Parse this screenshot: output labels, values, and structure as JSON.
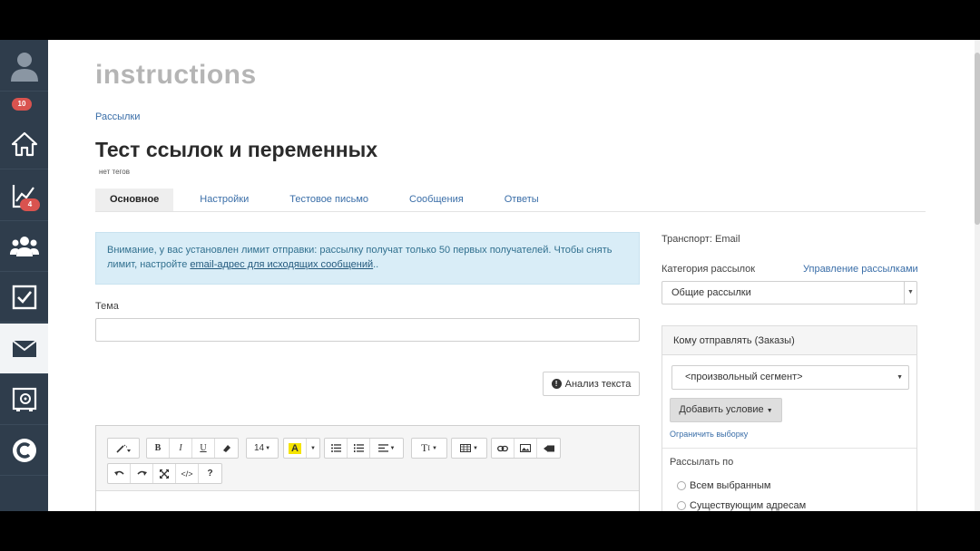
{
  "sidebar": {
    "notifications_badge": "10",
    "reports_badge": "4",
    "items": [
      {
        "name": "user",
        "icon": "user-icon"
      },
      {
        "name": "home",
        "icon": "home-icon"
      },
      {
        "name": "reports",
        "icon": "chart-icon"
      },
      {
        "name": "contacts",
        "icon": "group-icon"
      },
      {
        "name": "tasks",
        "icon": "checkbox-icon"
      },
      {
        "name": "mailings",
        "icon": "envelope-icon"
      },
      {
        "name": "safe",
        "icon": "safe-icon"
      },
      {
        "name": "brand",
        "icon": "c-logo-icon"
      }
    ],
    "colors": {
      "background": "#2f3d4c",
      "active": "#f2f4f6",
      "badge": "#d9534f"
    }
  },
  "header": {
    "logo": "instructions",
    "breadcrumb": "Рассылки",
    "title": "Тест ссылок и переменных",
    "tags": "нет тегов"
  },
  "tabs": [
    {
      "label": "Основное",
      "active": true
    },
    {
      "label": "Настройки",
      "active": false
    },
    {
      "label": "Тестовое письмо",
      "active": false
    },
    {
      "label": "Сообщения",
      "active": false
    },
    {
      "label": "Ответы",
      "active": false
    }
  ],
  "alert": {
    "text_before": "Внимание, у вас установлен лимит отправки: рассылку получат только 50 первых получателей. Чтобы снять лимит, настройте ",
    "link": "email-адрес для исходящих сообщений",
    "text_after": ".."
  },
  "form": {
    "subject_label": "Тема",
    "subject_value": "",
    "analysis_button": "Анализ текста"
  },
  "editor": {
    "font_size": "14",
    "toolbar_row1": [
      "magic-icon",
      "bold",
      "italic",
      "underline",
      "eraser-icon",
      "font-size",
      "highlight",
      "bullet-list",
      "numbered-list",
      "align",
      "text-style",
      "table",
      "link",
      "image",
      "video"
    ],
    "toolbar_row2": [
      "undo",
      "redo",
      "fullscreen",
      "code-view",
      "help"
    ],
    "labels": {
      "bold": "B",
      "italic": "I",
      "underline": "U",
      "help": "?",
      "code": "</>",
      "text_style": "T"
    }
  },
  "right": {
    "transport": "Транспорт: Email",
    "category_label": "Категория рассылок",
    "manage_link": "Управление рассылками",
    "category_value": "Общие рассылки",
    "panel_title": "Кому отправлять (Заказы)",
    "segment_value": "<произвольный сегмент>",
    "add_condition": "Добавить условие",
    "limit_link": "Ограничить выборку",
    "send_by_label": "Рассылать по",
    "radio_options": [
      "Всем выбранным",
      "Существующим адресам"
    ]
  }
}
